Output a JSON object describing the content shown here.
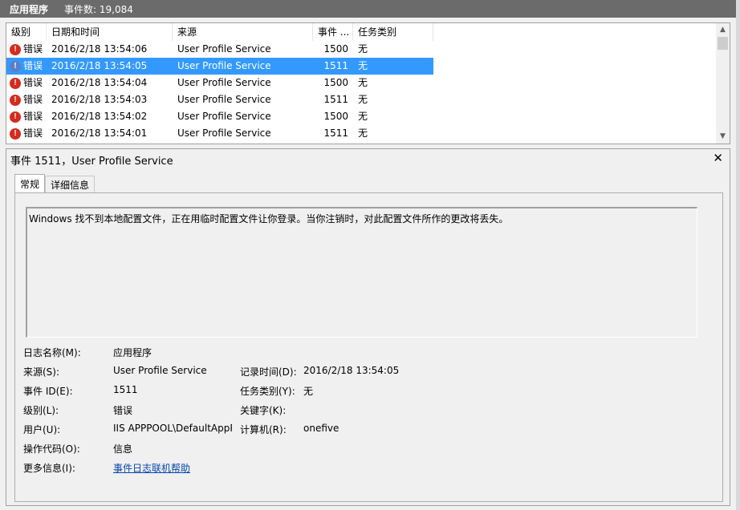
{
  "titlebar": {
    "app_name": "应用程序",
    "event_count": "事件数: 19,084"
  },
  "list": {
    "columns": [
      "级别",
      "日期和时间",
      "来源",
      "事件 ...",
      "任务类别"
    ],
    "rows": [
      {
        "level": "错误",
        "datetime": "2016/2/18 13:54:06",
        "source": "User Profile Service",
        "event_id": "1500",
        "task": "无"
      },
      {
        "level": "错误",
        "datetime": "2016/2/18 13:54:05",
        "source": "User Profile Service",
        "event_id": "1511",
        "task": "无"
      },
      {
        "level": "错误",
        "datetime": "2016/2/18 13:54:04",
        "source": "User Profile Service",
        "event_id": "1500",
        "task": "无"
      },
      {
        "level": "错误",
        "datetime": "2016/2/18 13:54:03",
        "source": "User Profile Service",
        "event_id": "1511",
        "task": "无"
      },
      {
        "level": "错误",
        "datetime": "2016/2/18 13:54:02",
        "source": "User Profile Service",
        "event_id": "1500",
        "task": "无"
      },
      {
        "level": "错误",
        "datetime": "2016/2/18 13:54:01",
        "source": "User Profile Service",
        "event_id": "1511",
        "task": "无"
      }
    ],
    "selected_index": 1,
    "scroll_up_icon": "chevron-up-icon",
    "scroll_down_icon": "chevron-down-icon"
  },
  "detail": {
    "title": "事件 1511，User Profile Service",
    "close_icon": "close-icon",
    "tabs": [
      "常规",
      "详细信息"
    ],
    "active_tab": 0,
    "message": "Windows 找不到本地配置文件，正在用临时配置文件让你登录。当你注销时，对此配置文件所作的更改将丢失。",
    "props": {
      "log_name_label": "日志名称(M):",
      "log_name": "应用程序",
      "source_label": "来源(S):",
      "source": "User Profile Service",
      "logged_label": "记录时间(D):",
      "logged": "2016/2/18 13:54:05",
      "event_id_label": "事件 ID(E):",
      "event_id": "1511",
      "task_label": "任务类别(Y):",
      "task": "无",
      "level_label": "级别(L):",
      "level": "错误",
      "keywords_label": "关键字(K):",
      "keywords": "",
      "user_label": "用户(U):",
      "user": "IIS APPPOOL\\DefaultAppPool",
      "computer_label": "计算机(R):",
      "computer": "onefive",
      "opcode_label": "操作代码(O):",
      "opcode": "信息",
      "more_info_label": "更多信息(I):",
      "more_info_link": "事件日志联机帮助"
    }
  },
  "colors": {
    "titlebar": "#6b6b6b",
    "selection": "#3399ff",
    "error_icon": "#d42b1e",
    "link": "#0645ad"
  }
}
